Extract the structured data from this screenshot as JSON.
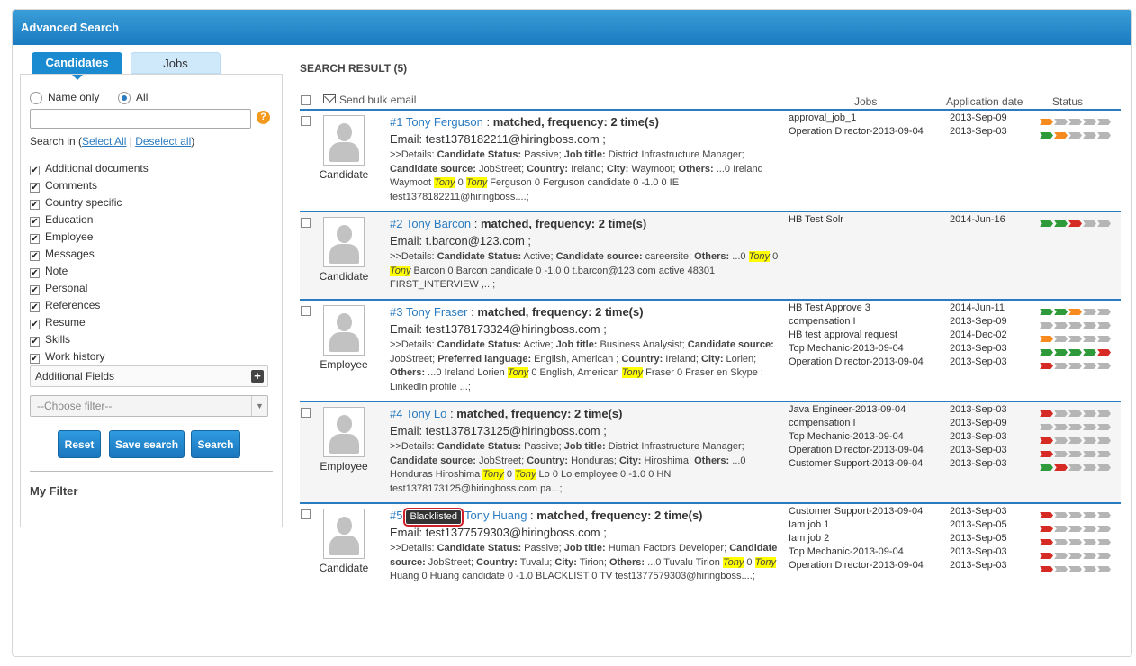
{
  "window": {
    "title": "Advanced Search"
  },
  "tabs": {
    "candidates": "Candidates",
    "jobs": "Jobs"
  },
  "search": {
    "name_only": "Name only",
    "all": "All",
    "query": "",
    "help_glyph": "?",
    "search_in": "Search in (",
    "select_all": "Select All",
    "separator": "|",
    "deselect_all": "Deselect all",
    "close_paren": ")",
    "fields": [
      "Additional documents",
      "Comments",
      "Country specific",
      "Education",
      "Employee",
      "Messages",
      "Note",
      "Personal",
      "References",
      "Resume",
      "Skills",
      "Work history"
    ],
    "additional_fields": "Additional Fields",
    "choose_filter": "--Choose filter--",
    "reset": "Reset",
    "save_search": "Save search",
    "search_button": "Search",
    "my_filter": "My Filter"
  },
  "results": {
    "title": "SEARCH RESULT (5)",
    "send_bulk_email": "Send bulk email",
    "col_jobs": "Jobs",
    "col_date": "Application date",
    "col_status": "Status",
    "blacklisted": "Blacklisted",
    "items": [
      {
        "num": "#1",
        "name": "Tony Ferguson",
        "sep": " : ",
        "match": "matched, frequency: 2 time(s)",
        "email_label": "Email:",
        "email": "test1378182211@hiringboss.com ;",
        "role": "Candidate",
        "details_html": ">>Details: <b>Candidate Status:</b> Passive; <b>Job title:</b> District Infrastructure Manager; <b>Candidate source:</b> JobStreet; <b>Country:</b> Ireland; <b>City:</b> Waymoot; <b>Others:</b> ...0 Ireland Waymoot <span class=\"hl\">Tony</span> 0 <span class=\"hl\">Tony</span> Ferguson 0 Ferguson candidate 0 -1.0 0 IE test1378182211@hiringboss....;",
        "jobs": [
          "approval_job_1",
          "Operation Director-2013-09-04"
        ],
        "dates": [
          "2013-Sep-09",
          "2013-Sep-03"
        ],
        "status": [
          "oxxxx",
          "goxxx"
        ]
      },
      {
        "num": "#2",
        "name": "Tony Barcon",
        "sep": " : ",
        "match": "matched, frequency: 2 time(s)",
        "email_label": "Email:",
        "email": "t.barcon@123.com ;",
        "role": "Candidate",
        "details_html": ">>Details: <b>Candidate Status:</b> Active; <b>Candidate source:</b> careersite; <b>Others:</b> ...0 <span class=\"hl\">Tony</span> 0 <span class=\"hl\">Tony</span> Barcon 0 Barcon candidate 0 -1.0 0 t.barcon@123.com active 48301 FIRST_INTERVIEW ,...;",
        "jobs": [
          "HB Test Solr"
        ],
        "dates": [
          "2014-Jun-16"
        ],
        "status": [
          "ggrxx"
        ]
      },
      {
        "num": "#3",
        "name": "Tony Fraser",
        "sep": " : ",
        "match": "matched, frequency: 2 time(s)",
        "email_label": "Email:",
        "email": "test1378173324@hiringboss.com ;",
        "role": "Employee",
        "details_html": ">>Details: <b>Candidate Status:</b> Active; <b>Job title:</b> Business Analysist; <b>Candidate source:</b> JobStreet; <b>Preferred language:</b> English, American ; <b>Country:</b> Ireland; <b>City:</b> Lorien; <b>Others:</b> ...0 Ireland Lorien <span class=\"hl\">Tony</span> 0 English, American <span class=\"hl\">Tony</span> Fraser 0 Fraser en Skype : LinkedIn profile ...;",
        "jobs": [
          "HB Test Approve 3",
          "compensation I",
          "HB test approval request",
          "Top Mechanic-2013-09-04",
          "Operation Director-2013-09-04"
        ],
        "dates": [
          "2014-Jun-11",
          "2013-Sep-09",
          "2014-Dec-02",
          "2013-Sep-03",
          "2013-Sep-03"
        ],
        "status": [
          "ggoxx",
          "xxxxx",
          "oxxxx",
          "ggggr",
          "rxxxx"
        ]
      },
      {
        "num": "#4",
        "name": "Tony Lo",
        "sep": " : ",
        "match": "matched, frequency: 2 time(s)",
        "email_label": "Email:",
        "email": "test1378173125@hiringboss.com ;",
        "role": "Employee",
        "details_html": ">>Details: <b>Candidate Status:</b> Passive; <b>Job title:</b> District Infrastructure Manager; <b>Candidate source:</b> JobStreet; <b>Country:</b> Honduras; <b>City:</b> Hiroshima; <b>Others:</b> ...0 Honduras Hiroshima <span class=\"hl\">Tony</span> 0 <span class=\"hl\">Tony</span> Lo 0 Lo employee 0 -1.0 0 HN test1378173125@hiringboss.com pa...;",
        "jobs": [
          "Java Engineer-2013-09-04",
          "compensation I",
          "Top Mechanic-2013-09-04",
          "Operation Director-2013-09-04",
          "Customer Support-2013-09-04"
        ],
        "dates": [
          "2013-Sep-03",
          "2013-Sep-09",
          "2013-Sep-03",
          "2013-Sep-03",
          "2013-Sep-03"
        ],
        "status": [
          "rxxxx",
          "xxxxx",
          "rxxxx",
          "rxxxx",
          "grxxx"
        ]
      },
      {
        "num": "#5",
        "name": "Tony Huang",
        "sep": " : ",
        "match": "matched, frequency: 2 time(s)",
        "email_label": "Email:",
        "email": "test1377579303@hiringboss.com ;",
        "role": "Candidate",
        "details_html": ">>Details: <b>Candidate Status:</b> Passive; <b>Job title:</b> Human Factors Developer; <b>Candidate source:</b> JobStreet; <b>Country:</b> Tuvalu; <b>City:</b> Tirion; <b>Others:</b> ...0 Tuvalu Tirion <span class=\"hl\">Tony</span> 0 <span class=\"hl\">Tony</span> Huang 0 Huang candidate 0 -1.0 BLACKLIST 0 TV test1377579303@hiringboss....;",
        "jobs": [
          "Customer Support-2013-09-04",
          "Iam job 1",
          "Iam job 2",
          "Top Mechanic-2013-09-04",
          "Operation Director-2013-09-04"
        ],
        "dates": [
          "2013-Sep-03",
          "2013-Sep-05",
          "2013-Sep-05",
          "2013-Sep-03",
          "2013-Sep-03"
        ],
        "status": [
          "rxxxx",
          "rxxxx",
          "rxxxx",
          "rxxxx",
          "rxxxx"
        ],
        "blacklisted": true
      }
    ]
  },
  "colors": {
    "accent": "#1a8bd0",
    "link": "#2a7bc0",
    "highlight": "#ffff00",
    "green": "#2e9a3a",
    "orange": "#f68a1f",
    "red": "#d62b24",
    "grey": "#b5b5b5"
  }
}
